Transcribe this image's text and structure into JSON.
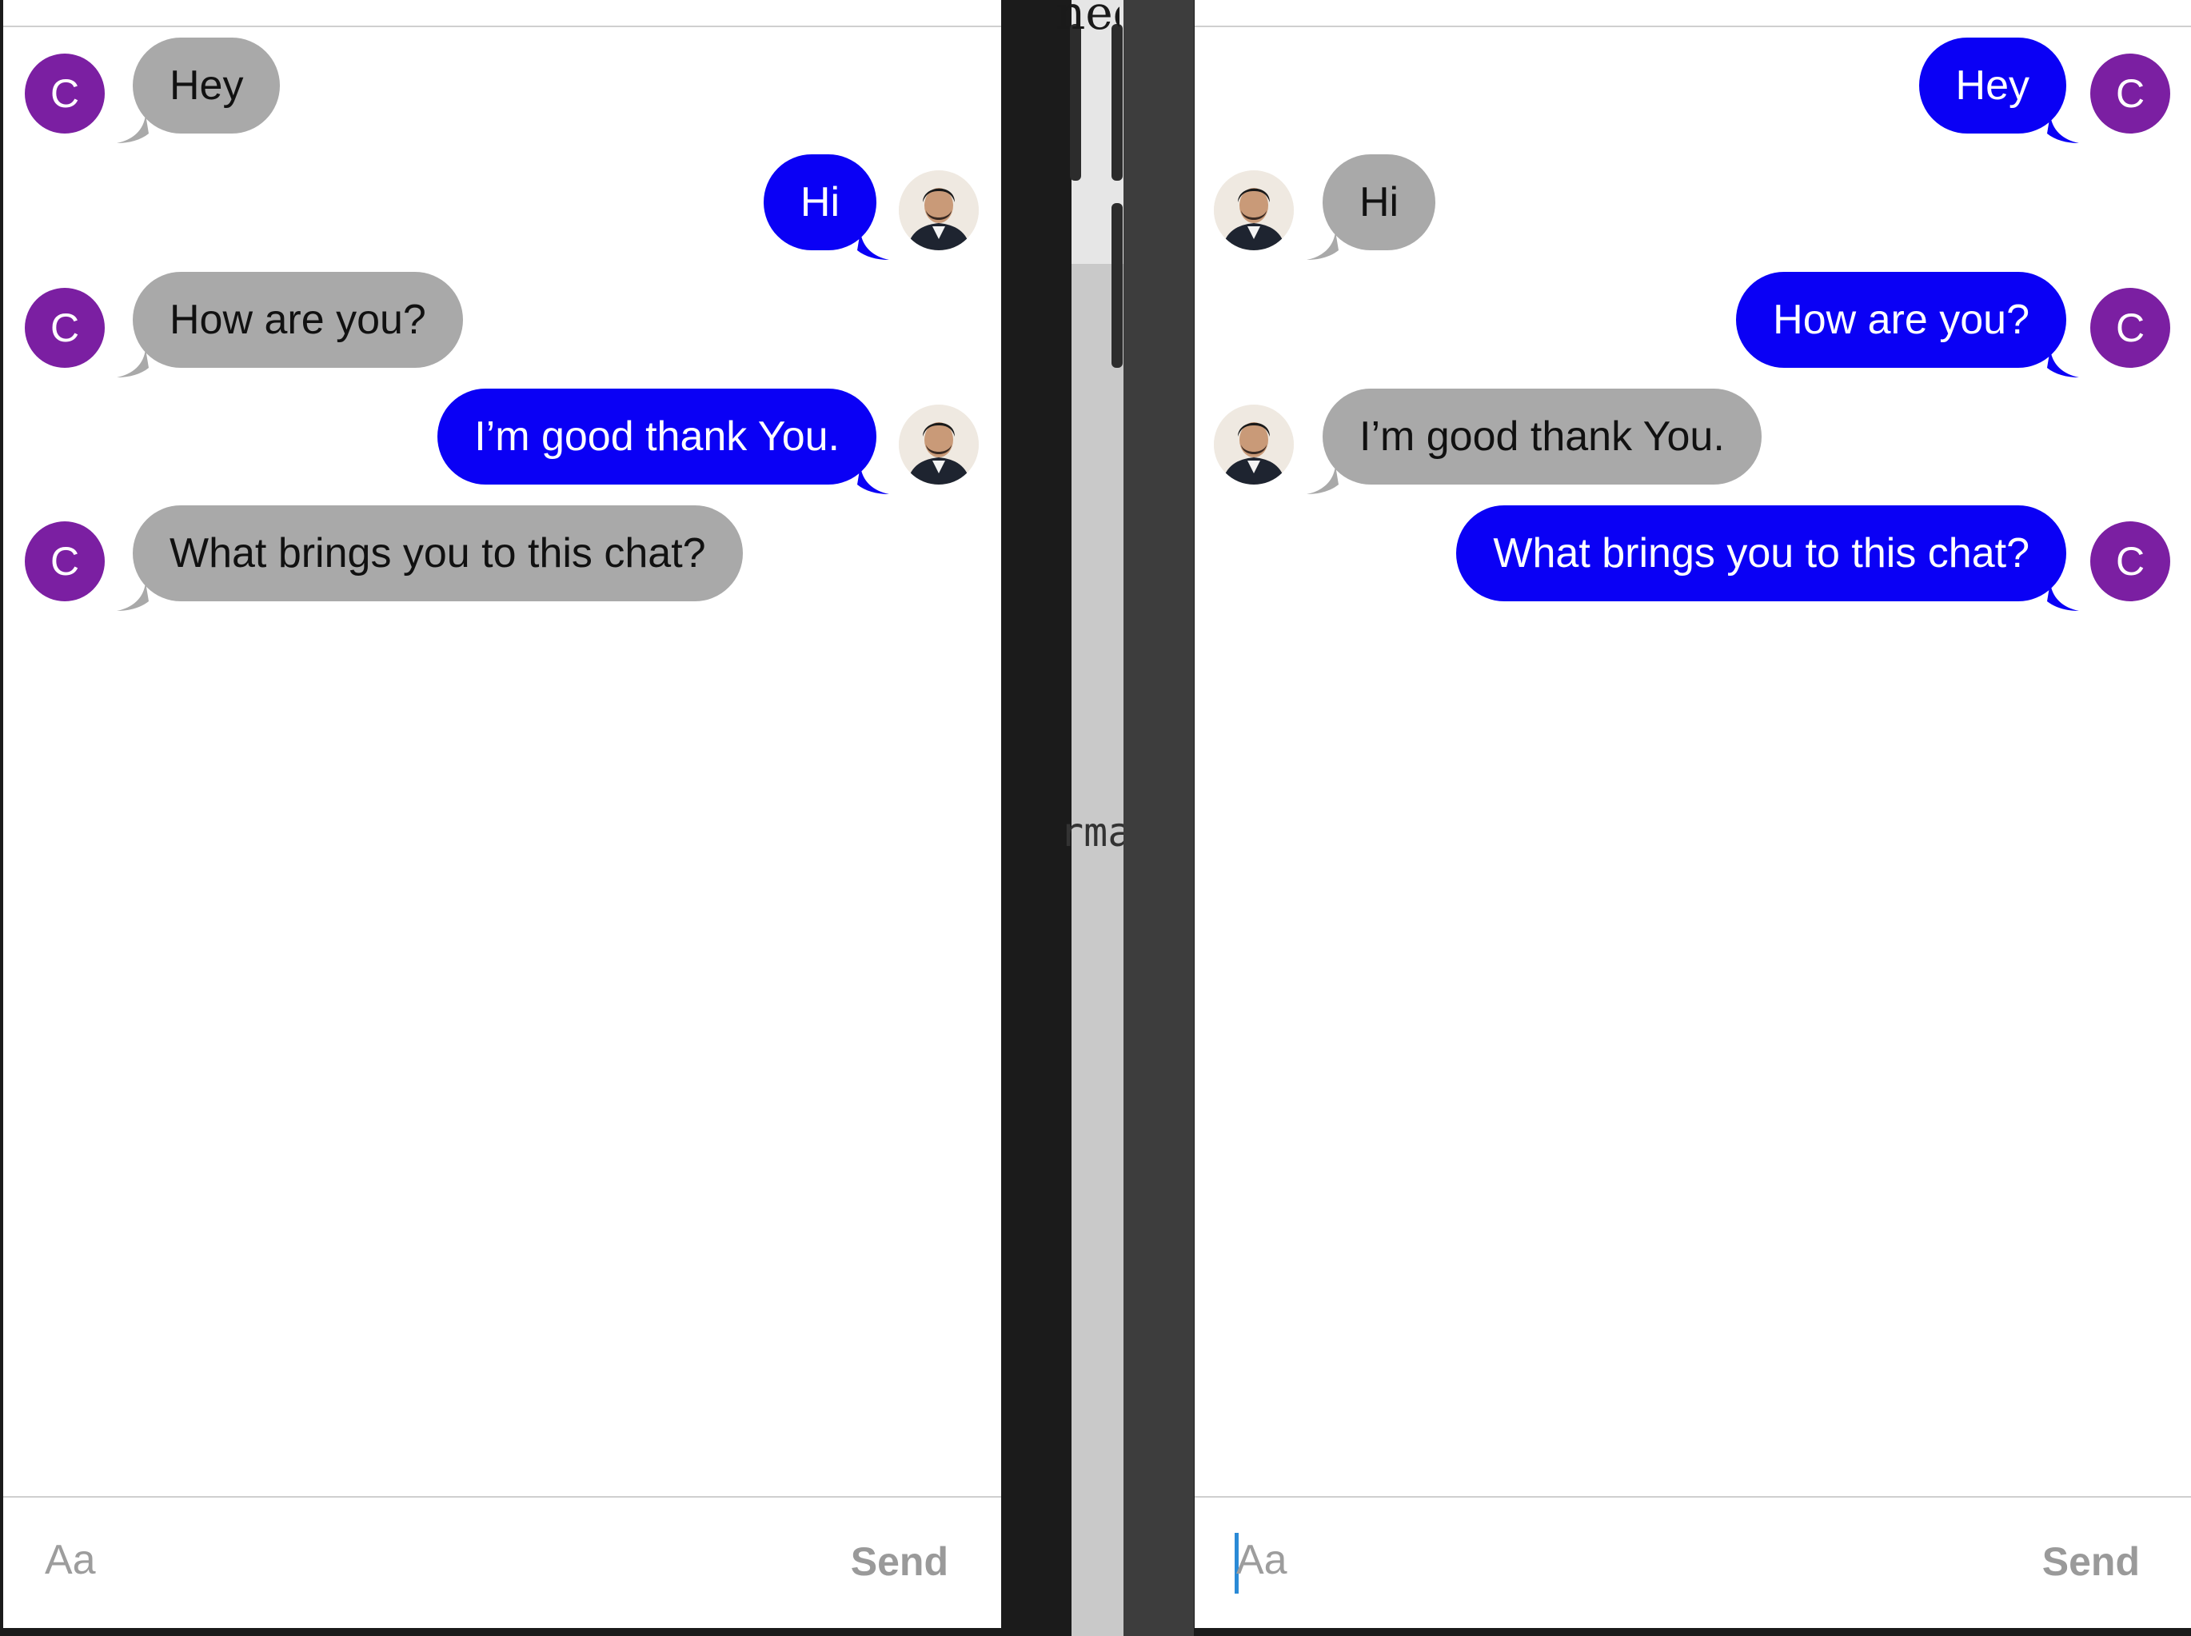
{
  "background": {
    "fragment_top": "nee",
    "fragment_mid": "rma"
  },
  "avatar_letter": "C",
  "colors": {
    "incoming_bubble": "#a9a9a9",
    "outgoing_bubble": "#0a00f5",
    "avatar_purple": "#7b1fa2",
    "caret": "#2a8ad6"
  },
  "left_pane": {
    "messages": [
      {
        "text": "Hey",
        "sender": "C",
        "side": "incoming"
      },
      {
        "text": "Hi",
        "sender": "photo-user",
        "side": "outgoing"
      },
      {
        "text": "How are you?",
        "sender": "C",
        "side": "incoming"
      },
      {
        "text": "I’m good thank You.",
        "sender": "photo-user",
        "side": "outgoing"
      },
      {
        "text": "What brings you to this chat?",
        "sender": "C",
        "side": "incoming"
      }
    ],
    "composer": {
      "placeholder": "Aa",
      "value": "",
      "send_label": "Send"
    }
  },
  "right_pane": {
    "messages": [
      {
        "text": "Hey",
        "sender": "C",
        "side": "outgoing"
      },
      {
        "text": "Hi",
        "sender": "photo-user",
        "side": "incoming"
      },
      {
        "text": "How are you?",
        "sender": "C",
        "side": "outgoing"
      },
      {
        "text": "I’m good thank You.",
        "sender": "photo-user",
        "side": "incoming"
      },
      {
        "text": "What brings you to this chat?",
        "sender": "C",
        "side": "outgoing"
      }
    ],
    "composer": {
      "placeholder": "Aa",
      "value": "",
      "send_label": "Send"
    }
  }
}
